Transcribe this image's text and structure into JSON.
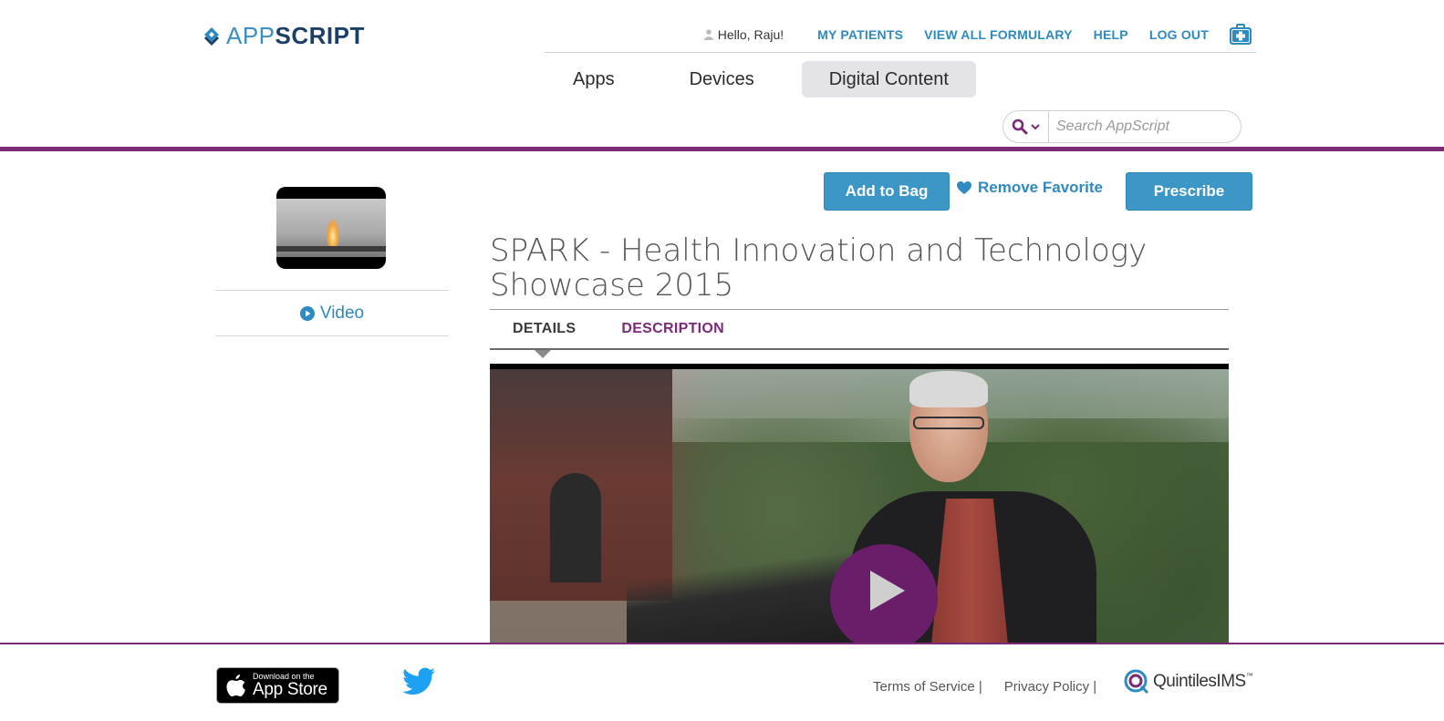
{
  "brand": {
    "app": "APP",
    "script": "SCRIPT"
  },
  "topnav": {
    "greeting": "Hello, Raju!",
    "links": [
      "MY PATIENTS",
      "VIEW ALL FORMULARY",
      "HELP",
      "LOG OUT"
    ]
  },
  "mainnav": {
    "tabs": [
      "Apps",
      "Devices",
      "Digital Content"
    ],
    "active": "Digital Content"
  },
  "search": {
    "placeholder": "Search AppScript"
  },
  "sidebar": {
    "media_label": "Video"
  },
  "actions": {
    "add_to_bag": "Add to Bag",
    "remove_favorite": "Remove Favorite",
    "prescribe": "Prescribe"
  },
  "product": {
    "title": "SPARK - Health Innovation and Technology Showcase 2015"
  },
  "detail_tabs": {
    "details": "DETAILS",
    "description": "DESCRIPTION"
  },
  "footer": {
    "appstore_small": "Download on the",
    "appstore_big": "App Store",
    "terms": "Terms of Service |",
    "privacy": "Privacy Policy |",
    "partner": "QuintilesIMS",
    "partner_tm": "™"
  },
  "colors": {
    "purple": "#7b2a78",
    "blue": "#3c97c7",
    "navy": "#1b3f66"
  }
}
